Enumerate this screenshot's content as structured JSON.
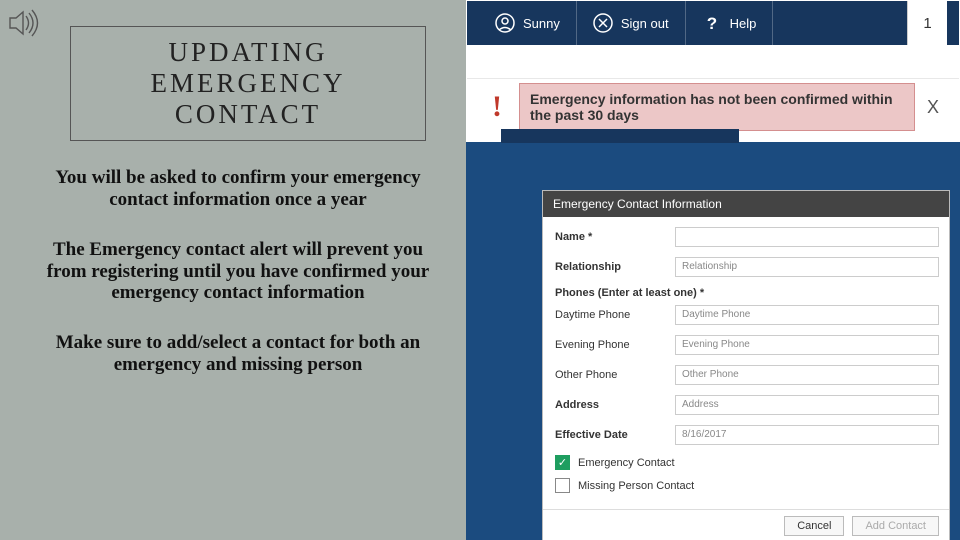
{
  "slide": {
    "title": "UPDATING EMERGENCY CONTACT",
    "paragraphs": [
      "You will be asked to confirm your emergency contact information once a year",
      "The Emergency contact alert will prevent you from registering until you have confirmed your emergency contact information",
      "Make sure to add/select a contact for both an emergency and missing person"
    ]
  },
  "header": {
    "items": [
      {
        "icon": "user-icon",
        "label": "Sunny"
      },
      {
        "icon": "signout-icon",
        "label": "Sign out"
      },
      {
        "icon": "help-icon",
        "label": "Help"
      }
    ],
    "page_number": "1"
  },
  "alert": {
    "bang": "!",
    "message": "Emergency information has not been confirmed within the past 30 days",
    "close": "X"
  },
  "form": {
    "header": "Emergency Contact Information",
    "labels": {
      "name": "Name *",
      "relationship": "Relationship",
      "phones_section": "Phones (Enter at least one) *",
      "daytime": "Daytime Phone",
      "evening": "Evening Phone",
      "other": "Other Phone",
      "address": "Address",
      "effective_date": "Effective Date",
      "emergency_contact": "Emergency Contact",
      "missing_person": "Missing Person Contact"
    },
    "placeholders": {
      "name": "",
      "relationship": "Relationship",
      "daytime": "Daytime Phone",
      "evening": "Evening Phone",
      "other": "Other Phone",
      "address": "Address",
      "effective_date": "8/16/2017"
    },
    "buttons": {
      "cancel": "Cancel",
      "add": "Add Contact"
    },
    "checks": {
      "emergency": true,
      "missing": false
    }
  }
}
